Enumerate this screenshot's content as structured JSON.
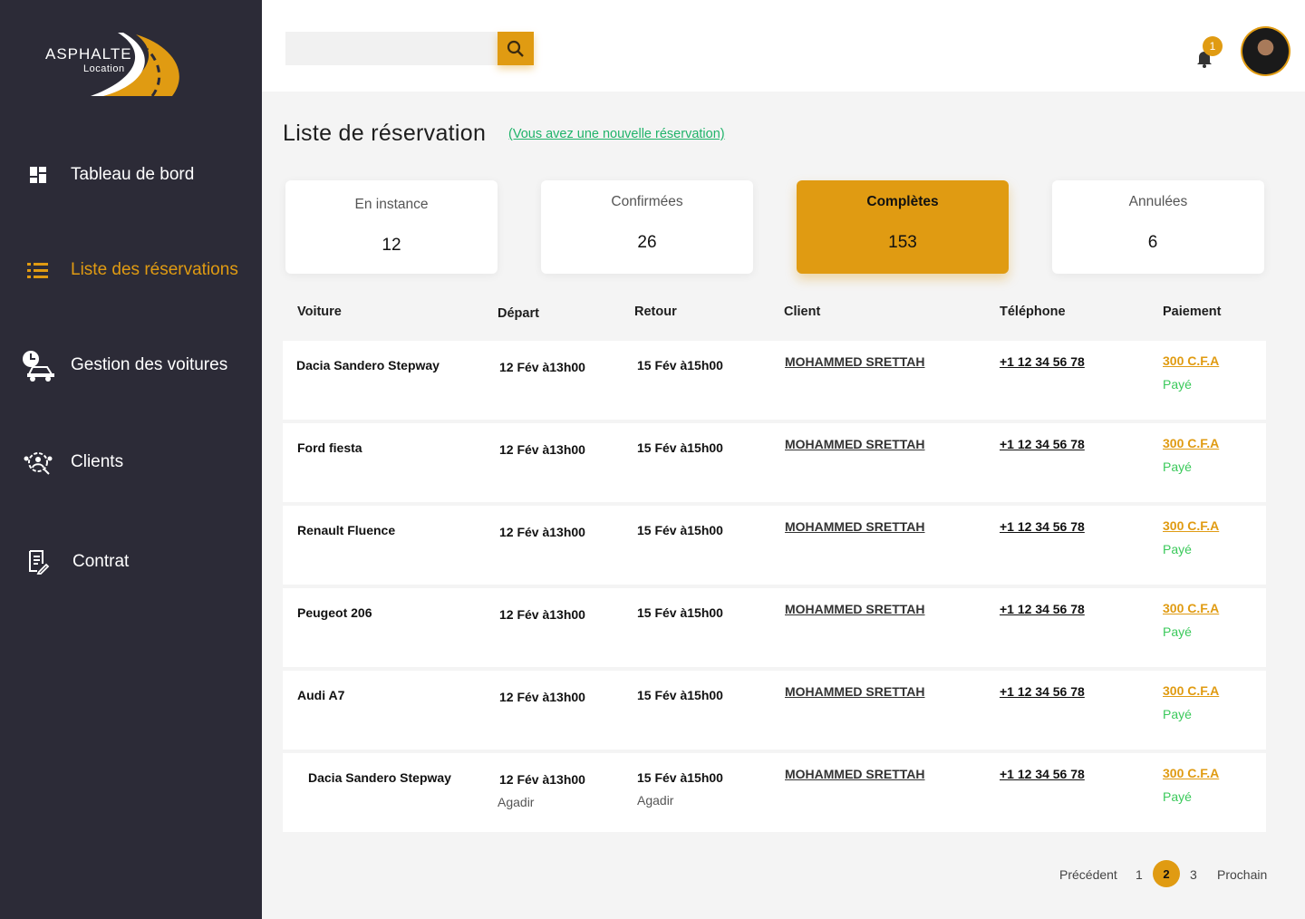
{
  "brand": {
    "name": "ASPHALTE",
    "sub": "Location",
    "accent": "#e09b12",
    "sidebar_bg": "#2c2b37"
  },
  "sidebar": {
    "items": [
      {
        "label": "Tableau de bord",
        "icon": "dashboard-grid-icon",
        "active": false
      },
      {
        "label": "Liste des réservations",
        "icon": "list-icon",
        "active": true
      },
      {
        "label": "Gestion des  voitures",
        "icon": "clock-car-icon",
        "active": false
      },
      {
        "label": "Clients",
        "icon": "clients-gear-icon",
        "active": false
      },
      {
        "label": "Contrat",
        "icon": "contract-icon",
        "active": false
      }
    ]
  },
  "topbar": {
    "search_placeholder": "",
    "notifications_count": "1"
  },
  "page": {
    "title": "Liste de réservation",
    "new_notice": "(Vous avez une nouvelle réservation)"
  },
  "cards": [
    {
      "label": "En instance",
      "value": "12",
      "active": false
    },
    {
      "label": "Confirmées",
      "value": "26",
      "active": false
    },
    {
      "label": "Complètes",
      "value": "153",
      "active": true
    },
    {
      "label": "Annulées",
      "value": "6",
      "active": false
    }
  ],
  "table": {
    "headers": [
      "Voiture",
      "Départ",
      "Retour",
      "Client",
      "Téléphone",
      "Paiement"
    ],
    "rows": [
      {
        "car": "Dacia Sandero Stepway",
        "depart": "12 Fév à13h00",
        "retour": "15 Fév à15h00",
        "client": "MOHAMMED SRETTAH",
        "phone": "+1 12 34 56 78",
        "amount": "300 C.F.A",
        "status": "Payé"
      },
      {
        "car": "Ford fiesta",
        "depart": "12 Fév à13h00",
        "retour": "15 Fév à15h00",
        "client": "MOHAMMED SRETTAH",
        "phone": "+1 12 34 56 78",
        "amount": "300 C.F.A",
        "status": "Payé"
      },
      {
        "car": "Renault Fluence",
        "depart": "12 Fév à13h00",
        "retour": "15 Fév à15h00",
        "client": "MOHAMMED SRETTAH",
        "phone": "+1 12 34 56 78",
        "amount": "300 C.F.A",
        "status": "Payé"
      },
      {
        "car": "Peugeot 206",
        "depart": "12 Fév à13h00",
        "retour": "15 Fév à15h00",
        "client": "MOHAMMED SRETTAH",
        "phone": "+1 12 34 56 78",
        "amount": "300 C.F.A",
        "status": "Payé"
      },
      {
        "car": "Audi A7",
        "depart": "12 Fév à13h00",
        "retour": "15 Fév à15h00",
        "client": "MOHAMMED SRETTAH",
        "phone": "+1 12 34 56 78",
        "amount": "300 C.F.A",
        "status": "Payé"
      },
      {
        "car": "Dacia Sandero Stepway",
        "depart": "12 Fév à13h00",
        "depart_city": "Agadir",
        "retour": "15 Fév à15h00",
        "retour_city": "Agadir",
        "client": "MOHAMMED SRETTAH",
        "phone": "+1 12 34 56 78",
        "amount": "300 C.F.A",
        "status": "Payé"
      }
    ]
  },
  "pagination": {
    "prev": "Précédent",
    "pages": [
      "1",
      "2",
      "3"
    ],
    "current": "2",
    "next": "Prochain"
  }
}
